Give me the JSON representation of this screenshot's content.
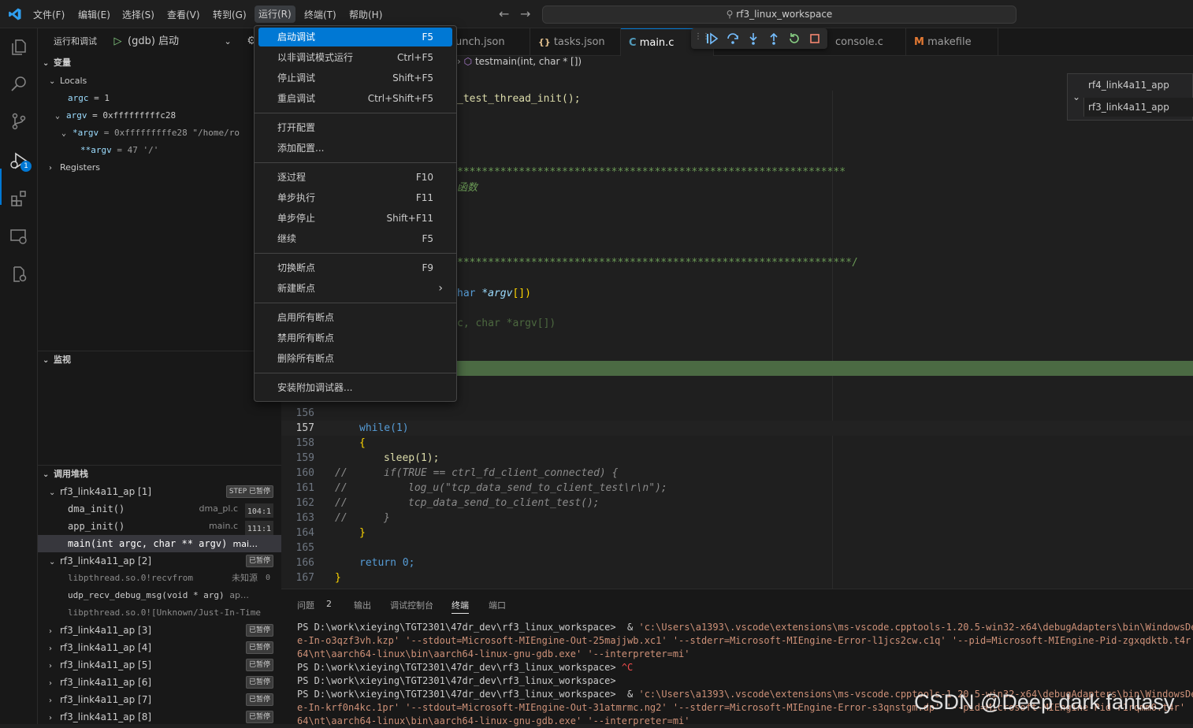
{
  "titlebar": {
    "menus": [
      "文件(F)",
      "编辑(E)",
      "选择(S)",
      "查看(V)",
      "转到(G)",
      "运行(R)",
      "终端(T)",
      "帮助(H)"
    ],
    "search_text": "rf3_linux_workspace"
  },
  "activity": {
    "badge": "1"
  },
  "sidebar": {
    "header": "运行和调试",
    "launch_config": "(gdb) 启动",
    "variables_title": "变量",
    "locals_label": "Locals",
    "vars": [
      {
        "name": "argc",
        "value": "= 1"
      },
      {
        "name": "argv",
        "value": "= 0xfffffffffc28"
      },
      {
        "name": "*argv",
        "value": "= 0xfffffffffe28 \"/home/ro"
      },
      {
        "name": "**argv",
        "value": "= 47 '/'"
      }
    ],
    "registers_label": "Registers",
    "watch_title": "监视",
    "callstack_title": "调用堆栈",
    "threads": [
      {
        "name": "rf3_link4a11_ap [1]",
        "tag": "STEP 已暂停"
      },
      {
        "name": "rf3_link4a11_ap [2]",
        "tag": "已暂停"
      },
      {
        "name": "rf3_link4a11_ap [3]",
        "tag": "已暂停"
      },
      {
        "name": "rf3_link4a11_ap [4]",
        "tag": "已暂停"
      },
      {
        "name": "rf3_link4a11_ap [5]",
        "tag": "已暂停"
      },
      {
        "name": "rf3_link4a11_ap [6]",
        "tag": "已暂停"
      },
      {
        "name": "rf3_link4a11_ap [7]",
        "tag": "已暂停"
      },
      {
        "name": "rf3_link4a11_ap [8]",
        "tag": "已暂停"
      }
    ],
    "frames1": [
      {
        "fn": "dma_init()",
        "file": "dma_pl.c",
        "line": "104:1"
      },
      {
        "fn": "app_init()",
        "file": "main.c",
        "line": "111:1"
      },
      {
        "fn": "main(int argc, char ** argv)",
        "file": "mai…",
        "line": ""
      }
    ],
    "frames2": [
      {
        "fn": "libpthread.so.0!recvfrom",
        "file": "未知源",
        "line": "0"
      },
      {
        "fn": "udp_recv_debug_msg(void * arg)",
        "file": "ap…",
        "line": ""
      },
      {
        "fn": "libpthread.so.0![Unknown/Just-In-Time",
        "file": "",
        "line": ""
      }
    ]
  },
  "editor": {
    "tabs": [
      "unch.json",
      "tasks.json",
      "main.c",
      "console.c",
      "makefile"
    ],
    "tab_icons": [
      "",
      "{}",
      "C",
      "",
      "M"
    ],
    "breadcrumb": "testmain(int, char * [])",
    "hover_items": [
      "rf4_link4a11_app",
      "rf3_link4a11_app"
    ],
    "partial_lines": {
      "l125": "_test_thread_init();",
      "l218": "***************************************************************",
      "l238": "函数",
      "l332": "****************************************************************/",
      "l372a": "har ",
      "l372b": "*argv",
      "l372c": "[])",
      "l410": "c, char *argv[])"
    },
    "code": [
      {
        "ln": "156",
        "text": ""
      },
      {
        "ln": "157",
        "text": "while(1)"
      },
      {
        "ln": "158",
        "text": "{"
      },
      {
        "ln": "159",
        "text": "sleep(1);"
      },
      {
        "ln": "160",
        "text": "if(TRUE == ctrl_fd_client_connected) {"
      },
      {
        "ln": "161",
        "text": "log_u(\"tcp_data_send_to_client_test\\r\\n\");"
      },
      {
        "ln": "162",
        "text": "tcp_data_send_to_client_test();"
      },
      {
        "ln": "163",
        "text": "}"
      },
      {
        "ln": "164",
        "text": "}"
      },
      {
        "ln": "165",
        "text": ""
      },
      {
        "ln": "166",
        "text": "return 0;"
      },
      {
        "ln": "167",
        "text": "}"
      }
    ]
  },
  "run_menu": {
    "items": [
      {
        "label": "启动调试",
        "key": "F5"
      },
      {
        "label": "以非调试模式运行",
        "key": "Ctrl+F5"
      },
      {
        "label": "停止调试",
        "key": "Shift+F5"
      },
      {
        "label": "重启调试",
        "key": "Ctrl+Shift+F5"
      },
      {
        "label": "打开配置",
        "key": ""
      },
      {
        "label": "添加配置...",
        "key": ""
      },
      {
        "label": "逐过程",
        "key": "F10"
      },
      {
        "label": "单步执行",
        "key": "F11"
      },
      {
        "label": "单步停止",
        "key": "Shift+F11"
      },
      {
        "label": "继续",
        "key": "F5"
      },
      {
        "label": "切换断点",
        "key": "F9"
      },
      {
        "label": "新建断点",
        "key": ""
      },
      {
        "label": "启用所有断点",
        "key": ""
      },
      {
        "label": "禁用所有断点",
        "key": ""
      },
      {
        "label": "删除所有断点",
        "key": ""
      },
      {
        "label": "安装附加调试器...",
        "key": ""
      }
    ]
  },
  "panel": {
    "tabs": [
      "问题",
      "2",
      "输出",
      "调试控制台",
      "终端",
      "端口"
    ],
    "terminal": [
      {
        "a": "PS D:\\work\\xieying\\TGT2301\\47dr_dev\\rf3_linux_workspace>  & ",
        "b": "'c:\\Users\\a1393\\.vscode\\extensions\\ms-vscode.cpptools-1.20.5-win32-x64\\debugAdapters\\bin\\WindowsDebugLa"
      },
      {
        "a": "",
        "b": "e-In-o3qzf3vh.kzp' '--stdout=Microsoft-MIEngine-Out-25majjwb.xc1' '--stderr=Microsoft-MIEngine-Error-l1jcs2cw.c1q' '--pid=Microsoft-MIEngine-Pid-zgxqdktb.t4r' '--"
      },
      {
        "a": "",
        "b": "64\\nt\\aarch64-linux\\bin\\aarch64-linux-gnu-gdb.exe' '--interpreter=mi'"
      },
      {
        "a": "PS D:\\work\\xieying\\TGT2301\\47dr_dev\\rf3_linux_workspace> ",
        "b": "",
        "c": "^C"
      },
      {
        "a": "PS D:\\work\\xieying\\TGT2301\\47dr_dev\\rf3_linux_workspace>",
        "b": ""
      },
      {
        "a": "PS D:\\work\\xieying\\TGT2301\\47dr_dev\\rf3_linux_workspace>  & ",
        "b": "'c:\\Users\\a1393\\.vscode\\extensions\\ms-vscode.cpptools-1.20.5-win32-x64\\debugAdapters\\bin\\WindowsDebugLa"
      },
      {
        "a": "",
        "b": "e-In-krf0n4kc.1pr' '--stdout=Microsoft-MIEngine-Out-31atmrmc.ng2' '--stderr=Microsoft-MIEngine-Error-s3qnstgm.dp' '--pid=Microsoft-MIEngine-Pid-r1rqmm0.t4r' '--"
      },
      {
        "a": "",
        "b": "64\\nt\\aarch64-linux\\bin\\aarch64-linux-gnu-gdb.exe' '--interpreter=mi'"
      }
    ]
  },
  "watermark": "CSDN @Deep dark fantasy",
  "colors": {
    "accent": "#0078d4",
    "highlight_line": "#4b6a43"
  }
}
